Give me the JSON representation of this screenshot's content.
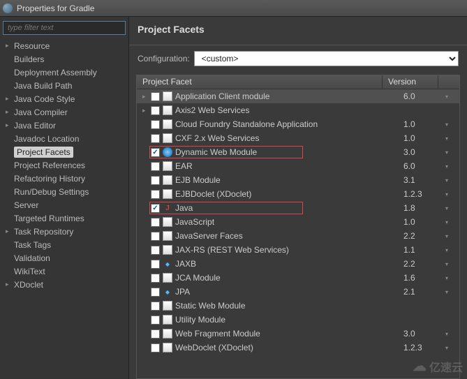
{
  "window": {
    "title": "Properties for Gradle"
  },
  "filter": {
    "placeholder": "type filter text"
  },
  "nav": [
    {
      "label": "Resource",
      "exp": true
    },
    {
      "label": "Builders",
      "exp": false
    },
    {
      "label": "Deployment Assembly",
      "exp": false
    },
    {
      "label": "Java Build Path",
      "exp": false
    },
    {
      "label": "Java Code Style",
      "exp": true
    },
    {
      "label": "Java Compiler",
      "exp": true
    },
    {
      "label": "Java Editor",
      "exp": true
    },
    {
      "label": "Javadoc Location",
      "exp": false
    },
    {
      "label": "Project Facets",
      "exp": false,
      "selected": true
    },
    {
      "label": "Project References",
      "exp": false
    },
    {
      "label": "Refactoring History",
      "exp": false
    },
    {
      "label": "Run/Debug Settings",
      "exp": false
    },
    {
      "label": "Server",
      "exp": false
    },
    {
      "label": "Targeted Runtimes",
      "exp": false
    },
    {
      "label": "Task Repository",
      "exp": true
    },
    {
      "label": "Task Tags",
      "exp": false
    },
    {
      "label": "Validation",
      "exp": false
    },
    {
      "label": "WikiText",
      "exp": false
    },
    {
      "label": "XDoclet",
      "exp": true
    }
  ],
  "page": {
    "heading": "Project Facets",
    "config_label": "Configuration:",
    "config_value": "<custom>",
    "col_facet": "Project Facet",
    "col_version": "Version"
  },
  "facets": [
    {
      "checked": false,
      "exp": true,
      "icon": "doc",
      "label": "Application Client module",
      "version": "6.0",
      "sel": true
    },
    {
      "checked": false,
      "exp": true,
      "icon": "doc",
      "label": "Axis2 Web Services",
      "version": ""
    },
    {
      "checked": false,
      "exp": false,
      "icon": "doc",
      "label": "Cloud Foundry Standalone Application",
      "version": "1.0"
    },
    {
      "checked": false,
      "exp": false,
      "icon": "doc",
      "label": "CXF 2.x Web Services",
      "version": "1.0"
    },
    {
      "checked": true,
      "exp": false,
      "icon": "globe",
      "label": "Dynamic Web Module",
      "version": "3.0",
      "hl": true,
      "hlw": 220
    },
    {
      "checked": false,
      "exp": false,
      "icon": "doc",
      "label": "EAR",
      "version": "6.0"
    },
    {
      "checked": false,
      "exp": false,
      "icon": "doc",
      "label": "EJB Module",
      "version": "3.1"
    },
    {
      "checked": false,
      "exp": false,
      "icon": "doc",
      "label": "EJBDoclet (XDoclet)",
      "version": "1.2.3"
    },
    {
      "checked": true,
      "exp": false,
      "icon": "java",
      "label": "Java",
      "version": "1.8",
      "hl": true,
      "hlw": 220
    },
    {
      "checked": false,
      "exp": false,
      "icon": "doc",
      "label": "JavaScript",
      "version": "1.0"
    },
    {
      "checked": false,
      "exp": false,
      "icon": "doc",
      "label": "JavaServer Faces",
      "version": "2.2"
    },
    {
      "checked": false,
      "exp": false,
      "icon": "doc",
      "label": "JAX-RS (REST Web Services)",
      "version": "1.1"
    },
    {
      "checked": false,
      "exp": false,
      "icon": "dia",
      "label": "JAXB",
      "version": "2.2"
    },
    {
      "checked": false,
      "exp": false,
      "icon": "doc",
      "label": "JCA Module",
      "version": "1.6"
    },
    {
      "checked": false,
      "exp": false,
      "icon": "dia",
      "label": "JPA",
      "version": "2.1"
    },
    {
      "checked": false,
      "exp": false,
      "icon": "doc",
      "label": "Static Web Module",
      "version": ""
    },
    {
      "checked": false,
      "exp": false,
      "icon": "doc",
      "label": "Utility Module",
      "version": ""
    },
    {
      "checked": false,
      "exp": false,
      "icon": "doc",
      "label": "Web Fragment Module",
      "version": "3.0"
    },
    {
      "checked": false,
      "exp": false,
      "icon": "doc",
      "label": "WebDoclet (XDoclet)",
      "version": "1.2.3"
    }
  ],
  "watermark": "亿速云"
}
